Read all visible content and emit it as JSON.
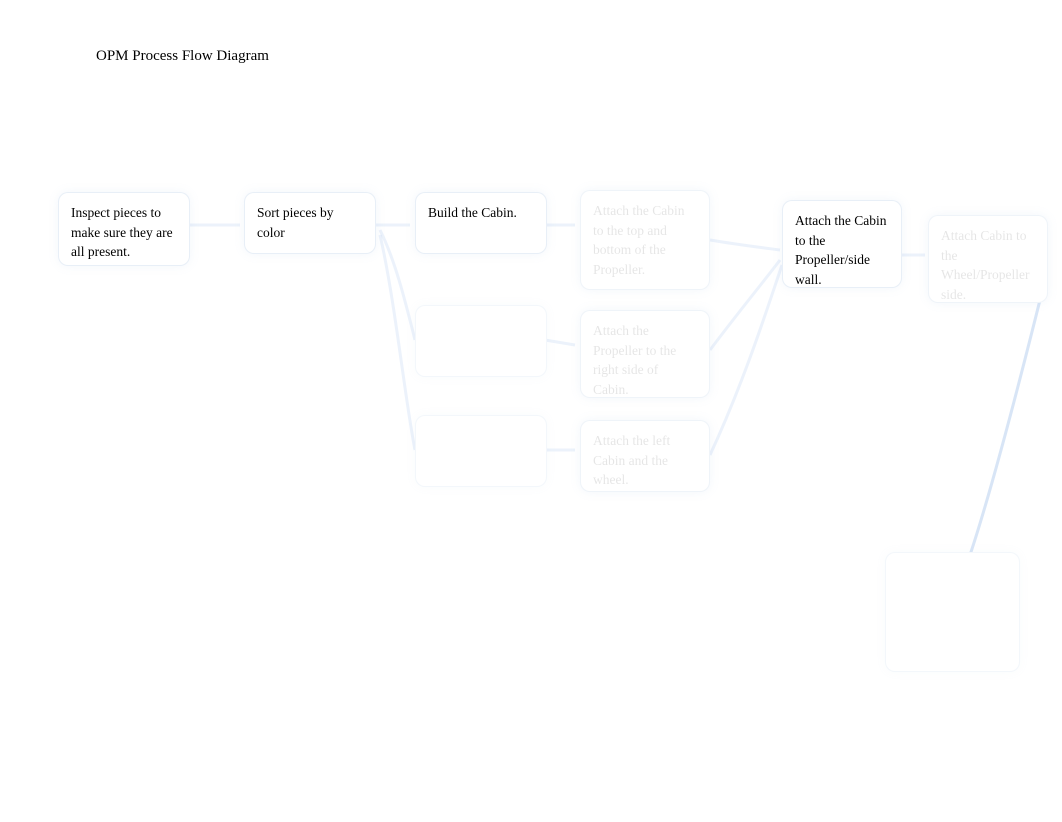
{
  "title": "OPM Process Flow Diagram",
  "nodes": {
    "inspect": "Inspect pieces to make sure they are all present.",
    "sort": "Sort pieces by color",
    "build_cabin": "Build the Cabin.",
    "build_mid1": "",
    "build_mid2": "",
    "attach_right1": "Attach the Cabin to the top and bottom of the Propeller.",
    "attach_right2": "Attach the Propeller to the right side of Cabin.",
    "attach_right3": "Attach the left Cabin and the wheel.",
    "attach_cabin_propeller": "Attach the Cabin to the Propeller/side wall.",
    "far_right": "Attach Cabin to the Wheel/Propeller side.",
    "bottom_right": ""
  }
}
